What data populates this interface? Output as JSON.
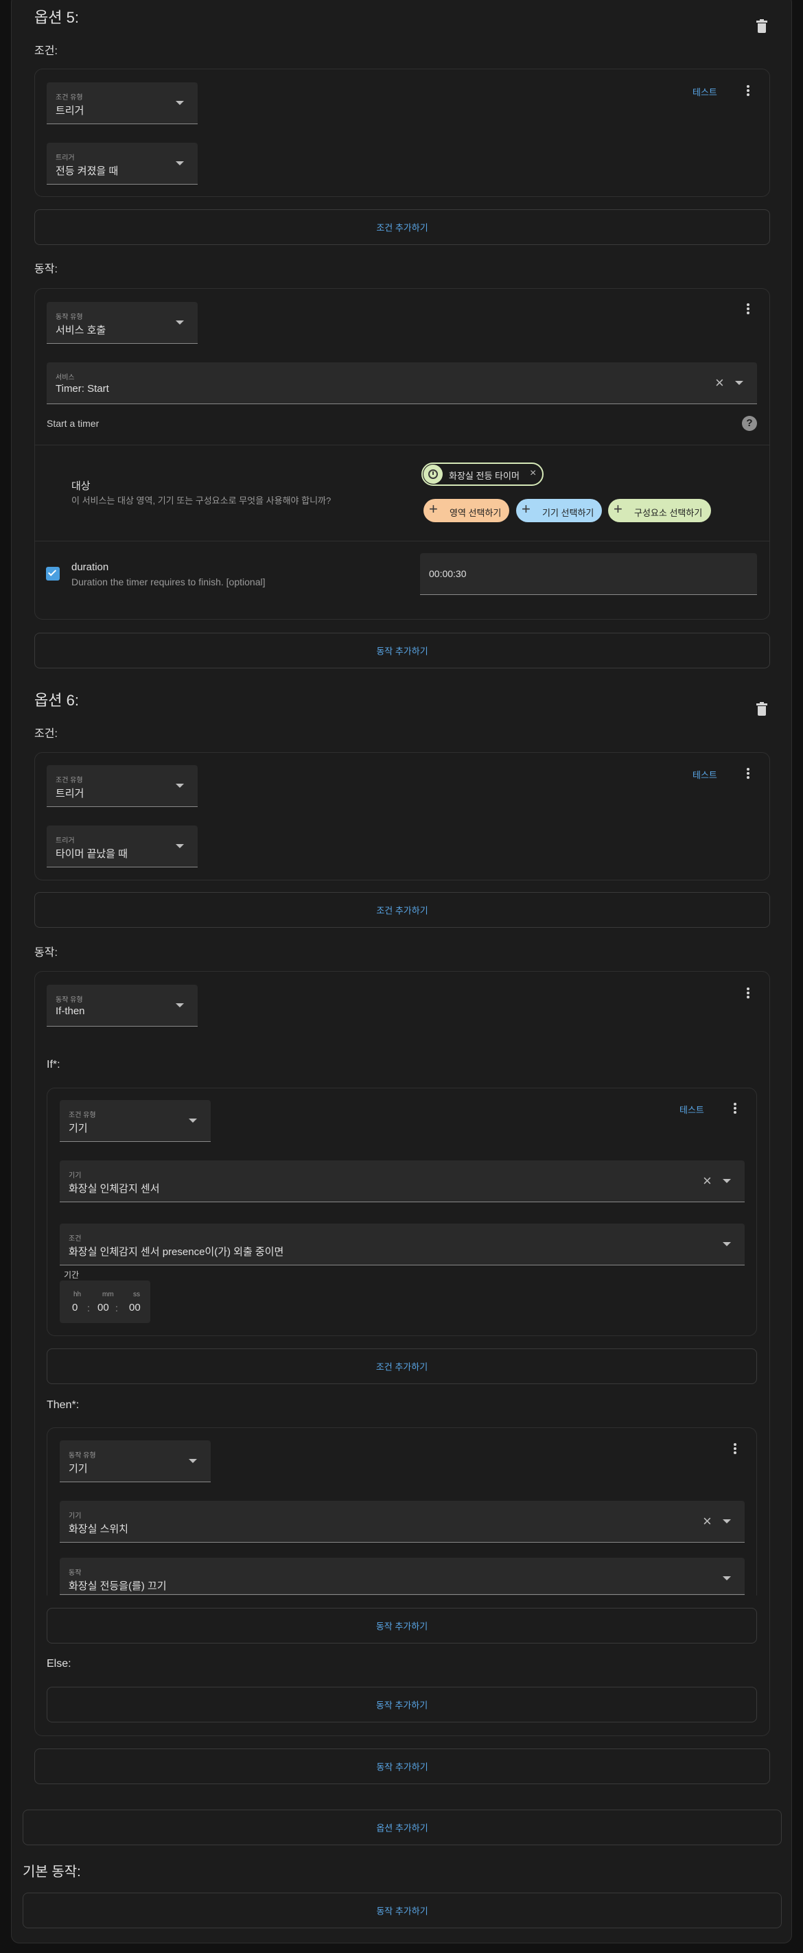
{
  "option5": {
    "title": "옵션 5:",
    "conditions_label": "조건:",
    "condition": {
      "type_label": "조건 유형",
      "type_value": "트리거",
      "test": "테스트",
      "trigger_label": "트리거",
      "trigger_value": "전등 켜졌을 때"
    },
    "add_condition": "조건 추가하기",
    "actions_label": "동작:",
    "action": {
      "type_label": "동작 유형",
      "type_value": "서비스 호출",
      "service_label": "서비스",
      "service_value": "Timer: Start",
      "description": "Start a timer",
      "help": "?",
      "target_title": "대상",
      "target_desc": "이 서비스는 대상 영역, 기기 또는 구성요소로 무엇을 사용해야 합니까?",
      "target_chip": "화장실 전등 타이머",
      "chip_area": "영역 선택하기",
      "chip_device": "기기 선택하기",
      "chip_entity": "구성요소 선택하기",
      "duration_title": "duration",
      "duration_desc": "Duration the timer requires to finish. [optional]",
      "duration_value": "00:00:30",
      "duration_checked": true
    },
    "add_action": "동작 추가하기"
  },
  "option6": {
    "title": "옵션 6:",
    "conditions_label": "조건:",
    "condition": {
      "type_label": "조건 유형",
      "type_value": "트리거",
      "test": "테스트",
      "trigger_label": "트리거",
      "trigger_value": "타이머 끝났을 때"
    },
    "add_condition": "조건 추가하기",
    "actions_label": "동작:",
    "action": {
      "type_label": "동작 유형",
      "type_value": "If-then",
      "if_label": "If*:",
      "if_condition": {
        "type_label": "조건 유형",
        "type_value": "기기",
        "test": "테스트",
        "device_label": "기기",
        "device_value": "화장실 인체감지 센서",
        "cond_label": "조건",
        "cond_value": "화장실 인체감지 센서 presence이(가) 외출 중이면",
        "duration_label": "기간",
        "hh_label": "hh",
        "mm_label": "mm",
        "ss_label": "ss",
        "hh": "0",
        "mm": "00",
        "ss": "00",
        "sep": ":"
      },
      "add_condition": "조건 추가하기",
      "then_label": "Then*:",
      "then_action": {
        "type_label": "동작 유형",
        "type_value": "기기",
        "device_label": "기기",
        "device_value": "화장실 스위치",
        "action_label": "동작",
        "action_value": "화장실 전등을(를) 끄기"
      },
      "add_action_then": "동작 추가하기",
      "else_label": "Else:",
      "add_action_else": "동작 추가하기"
    },
    "add_action": "동작 추가하기"
  },
  "add_option": "옵션 추가하기",
  "default_actions_label": "기본 동작:",
  "add_default_action": "동작 추가하기",
  "colors": {
    "accent": "#5aa7e8",
    "chip_area": "#f8c89a",
    "chip_device": "#a9d8f7",
    "chip_entity": "#d6e9b8",
    "checkbox": "#4a9fe0"
  }
}
